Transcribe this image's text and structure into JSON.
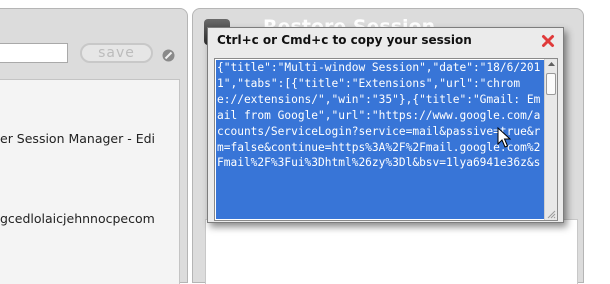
{
  "left_panel": {
    "save_label": "save",
    "session_items": [
      "er Session Manager - Edi",
      "gcedlolaicjehnnocpecom"
    ]
  },
  "right_panel": {
    "title": "Restore Session"
  },
  "dialog": {
    "header": "Ctrl+c or Cmd+c to copy your session",
    "session_text": "{\"title\":\"Multi-window Session\",\"date\":\"18/6/2011\",\"tabs\":[{\"title\":\"Extensions\",\"url\":\"chrome://extensions/\",\"win\":\"35\"},{\"title\":\"Gmail: Email from Google\",\"url\":\"https://www.google.com/accounts/ServiceLogin?service=mail&passive=true&rm=false&continue=https%3A%2F%2Fmail.google.com%2Fmail%2F%3Fui%3Dhtml%26zy%3Dl&bsv=1lya6941e36z&s"
  },
  "colors": {
    "selection": "#3875d7",
    "close_icon": "#e03a3a",
    "panel_bg": "#dcdcdc"
  },
  "icons": {
    "close": "close-icon",
    "pencil": "pencil-icon",
    "restore": "restore-icon",
    "cursor": "mouse-cursor-icon"
  }
}
